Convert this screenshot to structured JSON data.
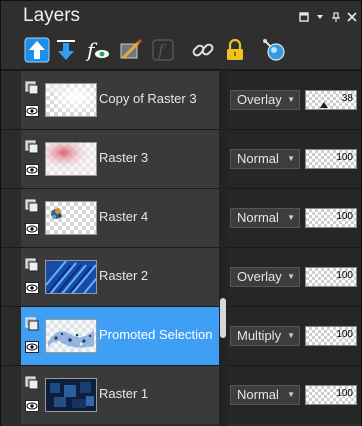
{
  "panel": {
    "title": "Layers",
    "title_buttons": [
      {
        "name": "restore-icon",
        "glyph": "◻"
      },
      {
        "name": "menu-dropdown-icon",
        "glyph": "▾"
      },
      {
        "name": "pin-icon",
        "glyph": "⊤"
      },
      {
        "name": "close-icon",
        "glyph": "✕"
      }
    ]
  },
  "toolbar": {
    "tools": [
      {
        "name": "move-layer-up-icon"
      },
      {
        "name": "move-layer-down-icon"
      },
      {
        "name": "visibility-toggle-icon"
      },
      {
        "name": "edit-mask-icon"
      },
      {
        "name": "disabled-tool-icon"
      },
      {
        "name": "link-layers-icon"
      },
      {
        "name": "lock-transparency-icon"
      },
      {
        "name": "layer-properties-icon"
      }
    ]
  },
  "layers": [
    {
      "name": "Copy of Raster 3",
      "blend_mode": "Overlay",
      "opacity": "38",
      "selected": false
    },
    {
      "name": "Raster 3",
      "blend_mode": "Normal",
      "opacity": "100",
      "selected": false
    },
    {
      "name": "Raster 4",
      "blend_mode": "Normal",
      "opacity": "100",
      "selected": false
    },
    {
      "name": "Raster 2",
      "blend_mode": "Overlay",
      "opacity": "100",
      "selected": false
    },
    {
      "name": "Promoted Selection",
      "blend_mode": "Multiply",
      "opacity": "100",
      "selected": true
    },
    {
      "name": "Raster 1",
      "blend_mode": "Normal",
      "opacity": "100",
      "selected": false
    }
  ],
  "colors": {
    "selection": "#3f9ff4",
    "panel_bg": "#2b2b2b",
    "row_bg": "#3a3a3a"
  }
}
